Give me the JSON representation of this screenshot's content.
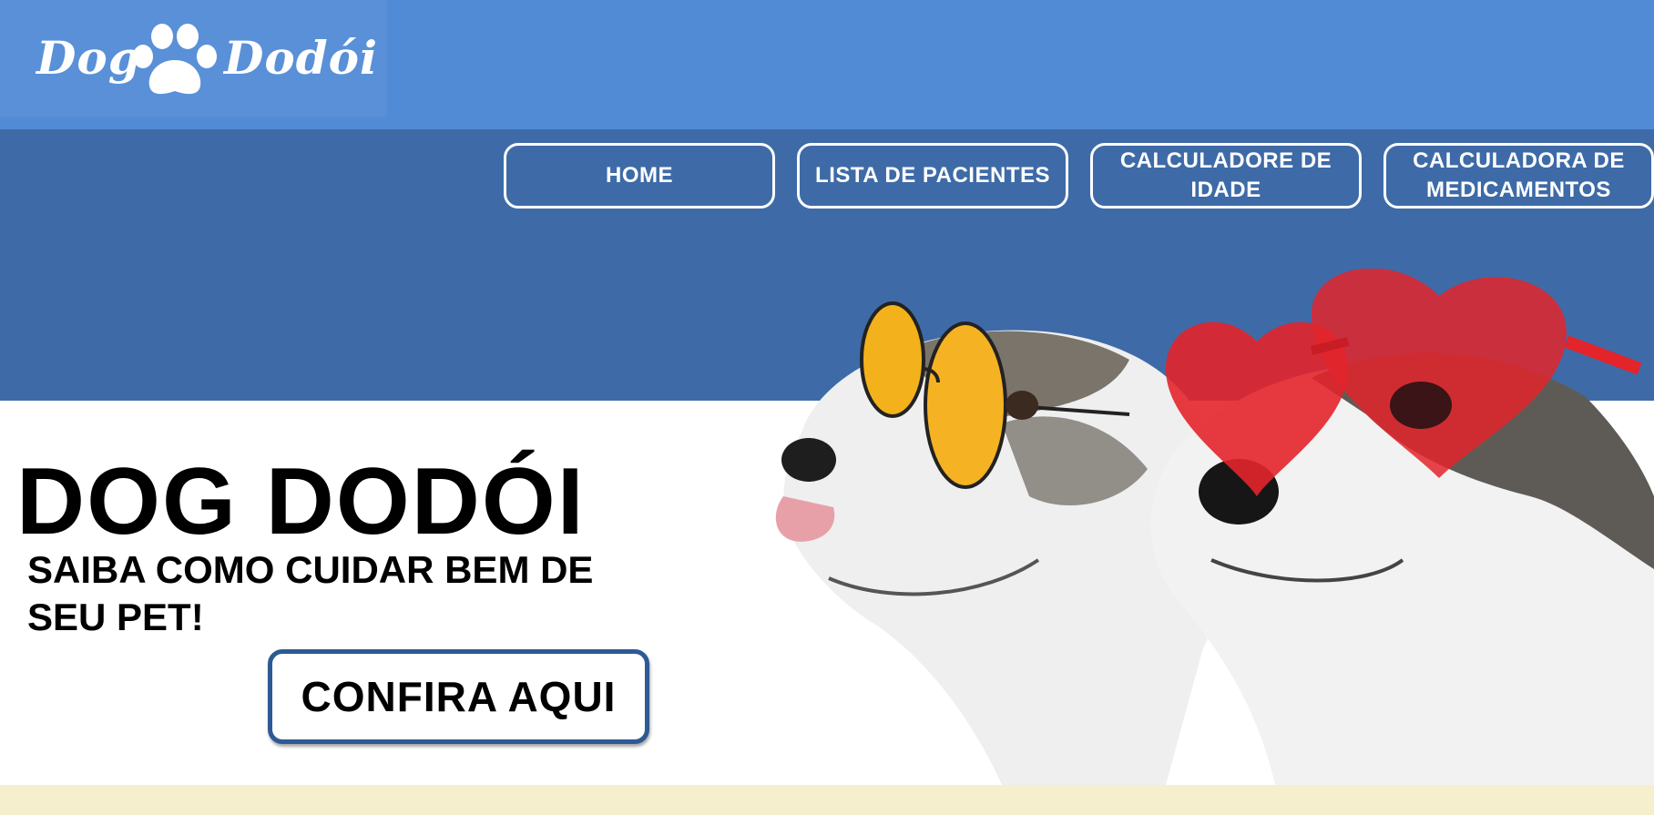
{
  "brand": {
    "logo_left": "Dog",
    "logo_right": "Dodói",
    "logo_icon": "paw-icon"
  },
  "nav": {
    "items": [
      {
        "lines": [
          "HOME"
        ]
      },
      {
        "lines": [
          "LISTA DE PACIENTES"
        ]
      },
      {
        "lines": [
          "CALCULADORE DE",
          "IDADE"
        ]
      },
      {
        "lines": [
          "CALCULADORA DE",
          "MEDICAMENTOS"
        ]
      }
    ]
  },
  "hero": {
    "title": "DOG DODÓI",
    "subtitle": "SAIBA COMO CUIDAR BEM DE SEU PET!",
    "cta_label": "CONFIRA AQUI",
    "image": "two-dogs-with-sunglasses-photo"
  },
  "colors": {
    "topbar": "#518bd6",
    "navband": "#3e6ba7",
    "footer": "#f6efcd",
    "cta_border": "#2d5a94"
  }
}
